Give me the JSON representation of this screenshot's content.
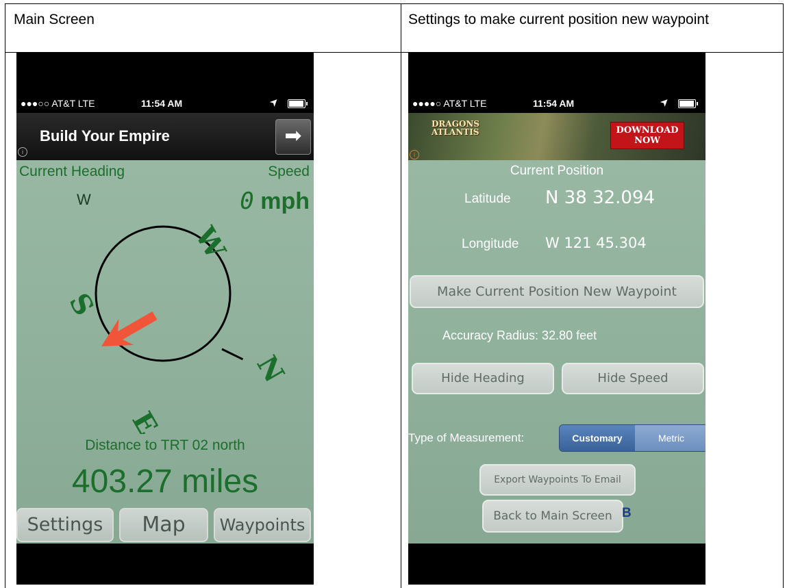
{
  "table": {
    "col1_header": "Main Screen",
    "col2_header": "Settings to make current position new waypoint"
  },
  "status": {
    "carrier": "●●●○○ AT&T  LTE",
    "carrier_right": "●●●●○ AT&T  LTE",
    "time": "11:54 AM",
    "location_glyph": "➤"
  },
  "main": {
    "ad_title": "Build Your Empire",
    "ad_arrow": "➡",
    "heading_label": "Current Heading",
    "heading_value": "W",
    "speed_label": "Speed",
    "speed_number": "0",
    "speed_unit": " mph",
    "compass": {
      "N": "N",
      "E": "E",
      "S": "S",
      "W": "W"
    },
    "distance_label": "Distance to TRT 02 north",
    "distance_value": "403.27 miles",
    "buttons": [
      "Settings",
      "Map",
      "Waypoints"
    ]
  },
  "settings": {
    "banner_logo_1": "DRAGONS",
    "banner_logo_2": "ATLANTIS",
    "banner_cta_1": "DOWNLOAD",
    "banner_cta_2": "NOW",
    "current_position": "Current Position",
    "latitude_label": "Latitude",
    "latitude_value": "N 38 32.094",
    "longitude_label": "Longitude",
    "longitude_value": "W 121 45.304",
    "make_waypoint_button": "Make Current Position New Waypoint",
    "accuracy": "Accuracy Radius:  32.80 feet",
    "hide_heading": "Hide Heading",
    "hide_speed": "Hide Speed",
    "measurement_label": "Type of Measurement:",
    "measurement_options": [
      "Customary",
      "Metric"
    ],
    "export_button": "Export Waypoints To Email",
    "back_button": "Back to Main Screen",
    "back_marker": "B"
  },
  "colors": {
    "screen_green": "#93b49f",
    "text_green": "#1b6e2c",
    "arrow_red": "#f0553a",
    "segment_selected": "#3f6aa3",
    "segment_unselected": "#6c8fbe"
  }
}
